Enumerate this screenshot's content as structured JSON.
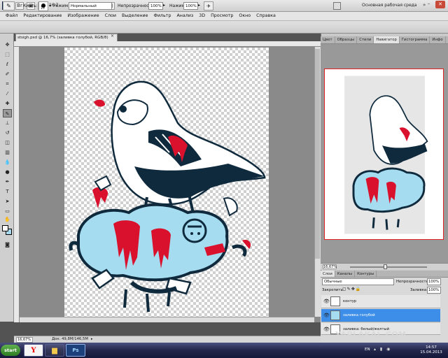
{
  "app": {
    "logo": "Ps",
    "zoom": "16,7",
    "workspace": "Основная рабочая среда"
  },
  "menu": [
    "Файл",
    "Редактирование",
    "Изображение",
    "Слои",
    "Выделение",
    "Фильтр",
    "Анализ",
    "3D",
    "Просмотр",
    "Окно",
    "Справка"
  ],
  "options": {
    "brush_label": "Кисть:",
    "brush_size": "10",
    "mode_label": "Режим:",
    "mode_value": "Нормальный",
    "opacity_label": "Непрозрачность:",
    "opacity_value": "100%",
    "flow_label": "Нажим:",
    "flow_value": "100%"
  },
  "document": {
    "tab_title": "stsigh.psd @ 16,7% (заливка голубой, RGB/8)",
    "close": "×",
    "status_zoom": "16,67%",
    "status_doc": "Док: 49,8M/146,5M"
  },
  "colors": {
    "foreground": "#ffffff",
    "background": "#a8d9ee",
    "art_dark": "#0f2a3d",
    "art_blue": "#a6dcf0",
    "art_red": "#d9112d"
  },
  "navigator": {
    "tabs": [
      "Цвет",
      "Образцы",
      "Стили",
      "Навигатор",
      "Гистограмма",
      "Инфо"
    ],
    "active_tab": "Навигатор",
    "zoom": "16,67%"
  },
  "layers_panel": {
    "tabs": [
      "Слои",
      "Каналы",
      "Контуры"
    ],
    "blend_mode": "Обычные",
    "opacity_label": "Непрозрачность:",
    "opacity_value": "100%",
    "lock_label": "Закрепить:",
    "fill_label": "Заливка:",
    "fill_value": "100%",
    "layers": [
      {
        "name": "контур",
        "selected": false
      },
      {
        "name": "заливка голубой",
        "selected": true
      },
      {
        "name": "заливка: белый/желтый",
        "selected": false
      }
    ]
  },
  "taskbar": {
    "start": "start",
    "lang": "EN",
    "time": "14:57",
    "date": "15.04.2013"
  },
  "watermark": "YAPLAKAL.COM"
}
